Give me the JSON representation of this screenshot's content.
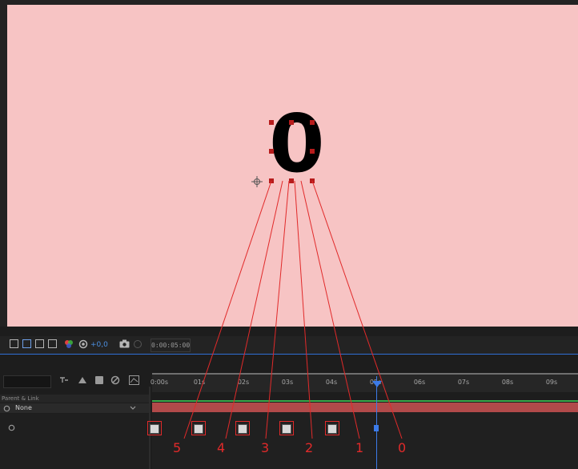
{
  "composition": {
    "digit": "0"
  },
  "toolbar": {
    "exposure": "+0,0",
    "timecode": "0:00:05:00"
  },
  "timeline": {
    "column_header": "Parent & Link",
    "parent_value": "None",
    "ruler_labels": [
      "0:00s",
      "01s",
      "02s",
      "03s",
      "04s",
      "05s",
      "06s",
      "07s",
      "08s",
      "09s"
    ]
  },
  "annotations": {
    "numbers": [
      "5",
      "4",
      "3",
      "2",
      "1",
      "0"
    ],
    "color": "#e12a2a"
  },
  "colors": {
    "canvas": "#f7c4c4",
    "layer_bar": "#b14a4a",
    "playhead": "#3c7be8"
  }
}
